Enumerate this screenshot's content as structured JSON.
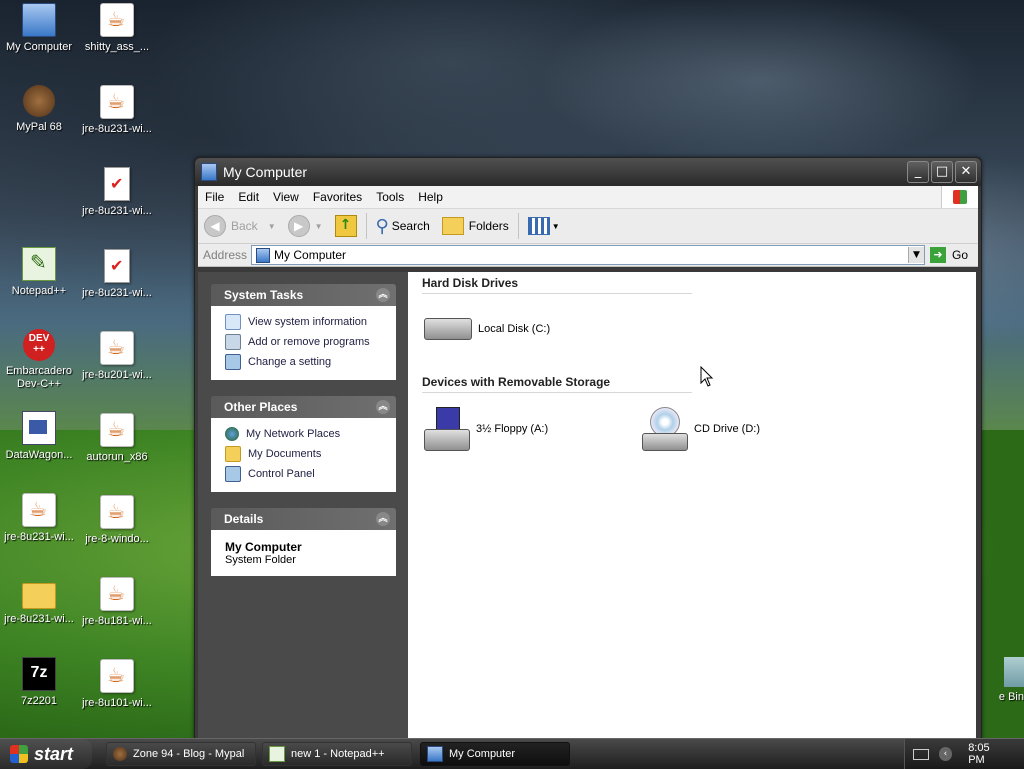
{
  "desktop": {
    "icons": [
      {
        "label": "My Computer",
        "icon": "my-computer-icon"
      },
      {
        "label": "shitty_ass_...",
        "icon": "java-icon"
      },
      {
        "label": "MyPal 68",
        "icon": "mypal-icon"
      },
      {
        "label": "jre-8u231-wi...",
        "icon": "java-icon"
      },
      {
        "label": "jre-8u231-wi...",
        "icon": "document-icon"
      },
      {
        "label": "Notepad++",
        "icon": "notepadpp-icon"
      },
      {
        "label": "jre-8u231-wi...",
        "icon": "document-icon"
      },
      {
        "label": "Embarcadero Dev-C++",
        "icon": "devcpp-icon"
      },
      {
        "label": "jre-8u201-wi...",
        "icon": "java-icon"
      },
      {
        "label": "DataWagon...",
        "icon": "datawagon-icon"
      },
      {
        "label": "autorun_x86",
        "icon": "java-icon"
      },
      {
        "label": "jre-8u231-wi...",
        "icon": "java-icon"
      },
      {
        "label": "jre-8-windo...",
        "icon": "java-icon"
      },
      {
        "label": "jre-8u231-wi...",
        "icon": "folder-icon"
      },
      {
        "label": "jre-8u181-wi...",
        "icon": "java-icon"
      },
      {
        "label": "7z2201",
        "icon": "7zip-icon"
      },
      {
        "label": "jre-8u101-wi...",
        "icon": "java-icon"
      }
    ],
    "devcpp_badge": "DEV\n++",
    "sevenzip_badge": "7z",
    "recycle_label": "e Bin"
  },
  "window": {
    "title": "My Computer",
    "menu": [
      "File",
      "Edit",
      "View",
      "Favorites",
      "Tools",
      "Help"
    ],
    "toolbar": {
      "back": "Back",
      "search": "Search",
      "folders": "Folders"
    },
    "address": {
      "label": "Address",
      "value": "My Computer",
      "go": "Go"
    },
    "tasks": {
      "system_title": "System Tasks",
      "system_items": [
        "View system information",
        "Add or remove programs",
        "Change a setting"
      ],
      "other_title": "Other Places",
      "other_items": [
        "My Network Places",
        "My Documents",
        "Control Panel"
      ],
      "details_title": "Details",
      "details_name": "My Computer",
      "details_type": "System Folder"
    },
    "sections": {
      "hdd_title": "Hard Disk Drives",
      "removable_title": "Devices with Removable Storage"
    },
    "drives": {
      "local": "Local Disk (C:)",
      "floppy": "3½ Floppy (A:)",
      "cd": "CD Drive (D:)"
    }
  },
  "taskbar": {
    "start": "start",
    "tasks": [
      "Zone 94 - Blog - Mypal",
      "new 1 - Notepad++",
      "My Computer"
    ],
    "clock": "8:05 PM"
  }
}
